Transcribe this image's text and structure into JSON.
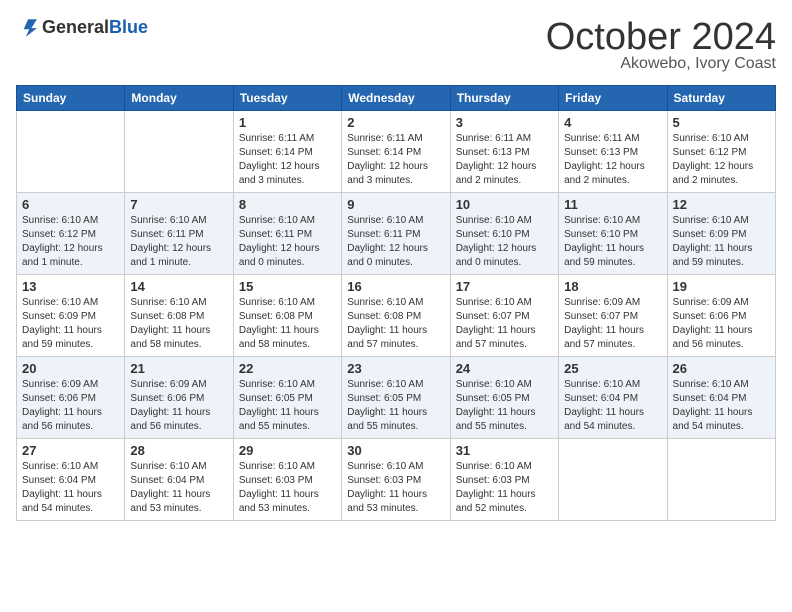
{
  "header": {
    "logo_general": "General",
    "logo_blue": "Blue",
    "month": "October 2024",
    "location": "Akowebo, Ivory Coast"
  },
  "weekdays": [
    "Sunday",
    "Monday",
    "Tuesday",
    "Wednesday",
    "Thursday",
    "Friday",
    "Saturday"
  ],
  "weeks": [
    [
      null,
      null,
      {
        "day": 1,
        "sunrise": "6:11 AM",
        "sunset": "6:14 PM",
        "daylight": "12 hours and 3 minutes."
      },
      {
        "day": 2,
        "sunrise": "6:11 AM",
        "sunset": "6:14 PM",
        "daylight": "12 hours and 3 minutes."
      },
      {
        "day": 3,
        "sunrise": "6:11 AM",
        "sunset": "6:13 PM",
        "daylight": "12 hours and 2 minutes."
      },
      {
        "day": 4,
        "sunrise": "6:11 AM",
        "sunset": "6:13 PM",
        "daylight": "12 hours and 2 minutes."
      },
      {
        "day": 5,
        "sunrise": "6:10 AM",
        "sunset": "6:12 PM",
        "daylight": "12 hours and 2 minutes."
      }
    ],
    [
      {
        "day": 6,
        "sunrise": "6:10 AM",
        "sunset": "6:12 PM",
        "daylight": "12 hours and 1 minute."
      },
      {
        "day": 7,
        "sunrise": "6:10 AM",
        "sunset": "6:11 PM",
        "daylight": "12 hours and 1 minute."
      },
      {
        "day": 8,
        "sunrise": "6:10 AM",
        "sunset": "6:11 PM",
        "daylight": "12 hours and 0 minutes."
      },
      {
        "day": 9,
        "sunrise": "6:10 AM",
        "sunset": "6:11 PM",
        "daylight": "12 hours and 0 minutes."
      },
      {
        "day": 10,
        "sunrise": "6:10 AM",
        "sunset": "6:10 PM",
        "daylight": "12 hours and 0 minutes."
      },
      {
        "day": 11,
        "sunrise": "6:10 AM",
        "sunset": "6:10 PM",
        "daylight": "11 hours and 59 minutes."
      },
      {
        "day": 12,
        "sunrise": "6:10 AM",
        "sunset": "6:09 PM",
        "daylight": "11 hours and 59 minutes."
      }
    ],
    [
      {
        "day": 13,
        "sunrise": "6:10 AM",
        "sunset": "6:09 PM",
        "daylight": "11 hours and 59 minutes."
      },
      {
        "day": 14,
        "sunrise": "6:10 AM",
        "sunset": "6:08 PM",
        "daylight": "11 hours and 58 minutes."
      },
      {
        "day": 15,
        "sunrise": "6:10 AM",
        "sunset": "6:08 PM",
        "daylight": "11 hours and 58 minutes."
      },
      {
        "day": 16,
        "sunrise": "6:10 AM",
        "sunset": "6:08 PM",
        "daylight": "11 hours and 57 minutes."
      },
      {
        "day": 17,
        "sunrise": "6:10 AM",
        "sunset": "6:07 PM",
        "daylight": "11 hours and 57 minutes."
      },
      {
        "day": 18,
        "sunrise": "6:09 AM",
        "sunset": "6:07 PM",
        "daylight": "11 hours and 57 minutes."
      },
      {
        "day": 19,
        "sunrise": "6:09 AM",
        "sunset": "6:06 PM",
        "daylight": "11 hours and 56 minutes."
      }
    ],
    [
      {
        "day": 20,
        "sunrise": "6:09 AM",
        "sunset": "6:06 PM",
        "daylight": "11 hours and 56 minutes."
      },
      {
        "day": 21,
        "sunrise": "6:09 AM",
        "sunset": "6:06 PM",
        "daylight": "11 hours and 56 minutes."
      },
      {
        "day": 22,
        "sunrise": "6:10 AM",
        "sunset": "6:05 PM",
        "daylight": "11 hours and 55 minutes."
      },
      {
        "day": 23,
        "sunrise": "6:10 AM",
        "sunset": "6:05 PM",
        "daylight": "11 hours and 55 minutes."
      },
      {
        "day": 24,
        "sunrise": "6:10 AM",
        "sunset": "6:05 PM",
        "daylight": "11 hours and 55 minutes."
      },
      {
        "day": 25,
        "sunrise": "6:10 AM",
        "sunset": "6:04 PM",
        "daylight": "11 hours and 54 minutes."
      },
      {
        "day": 26,
        "sunrise": "6:10 AM",
        "sunset": "6:04 PM",
        "daylight": "11 hours and 54 minutes."
      }
    ],
    [
      {
        "day": 27,
        "sunrise": "6:10 AM",
        "sunset": "6:04 PM",
        "daylight": "11 hours and 54 minutes."
      },
      {
        "day": 28,
        "sunrise": "6:10 AM",
        "sunset": "6:04 PM",
        "daylight": "11 hours and 53 minutes."
      },
      {
        "day": 29,
        "sunrise": "6:10 AM",
        "sunset": "6:03 PM",
        "daylight": "11 hours and 53 minutes."
      },
      {
        "day": 30,
        "sunrise": "6:10 AM",
        "sunset": "6:03 PM",
        "daylight": "11 hours and 53 minutes."
      },
      {
        "day": 31,
        "sunrise": "6:10 AM",
        "sunset": "6:03 PM",
        "daylight": "11 hours and 52 minutes."
      },
      null,
      null
    ]
  ]
}
